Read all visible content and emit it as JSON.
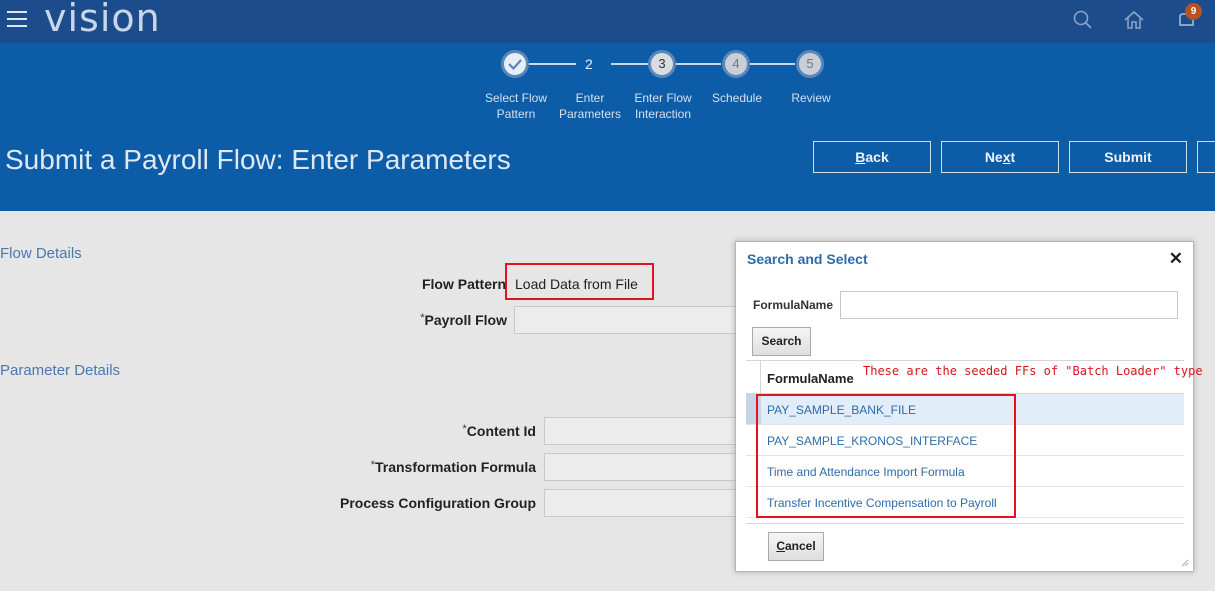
{
  "app": {
    "logo": "vision",
    "notification_count": "9",
    "icons": [
      "menu-icon",
      "search-icon",
      "home-icon",
      "notifications-icon"
    ]
  },
  "train": {
    "steps": [
      {
        "number": "",
        "label_line1": "Select Flow",
        "label_line2": "Pattern",
        "state": "done"
      },
      {
        "number": "2",
        "label_line1": "Enter",
        "label_line2": "Parameters",
        "state": "current"
      },
      {
        "number": "3",
        "label_line1": "Enter Flow",
        "label_line2": "Interaction",
        "state": "visited"
      },
      {
        "number": "4",
        "label_line1": "Schedule",
        "label_line2": "",
        "state": "unvisited"
      },
      {
        "number": "5",
        "label_line1": "Review",
        "label_line2": "",
        "state": "unvisited"
      }
    ]
  },
  "header": {
    "title": "Submit a Payroll Flow: Enter Parameters",
    "back_prefix": "",
    "back_hotkey": "B",
    "back_rest": "ack",
    "next_prefix": "Ne",
    "next_hotkey": "x",
    "next_rest": "t",
    "submit_label": "Submit"
  },
  "flow_details": {
    "section_title": "Flow Details",
    "flow_pattern_label": "Flow Pattern",
    "flow_pattern_value": "Load Data from File",
    "payroll_flow_label": "Payroll Flow",
    "required_mark": "*"
  },
  "parameter_details": {
    "section_title": "Parameter Details",
    "content_id_label": "Content Id",
    "transformation_formula_label": "Transformation Formula",
    "process_config_label": "Process Configuration Group",
    "required_mark": "*"
  },
  "dialog": {
    "title": "Search and Select",
    "close_glyph": "✕",
    "field_label": "FormulaName",
    "field_value": "",
    "search_label": "Search",
    "column_header": "FormulaName",
    "annotation": "These are the seeded FFs of \"Batch Loader\" type",
    "rows": [
      "PAY_SAMPLE_BANK_FILE",
      "PAY_SAMPLE_KRONOS_INTERFACE",
      "Time and Attendance Import Formula",
      "Transfer Incentive Compensation to Payroll"
    ],
    "cancel_hotkey": "C",
    "cancel_rest": "ancel"
  },
  "colors": {
    "topbar": "#1c4c8c",
    "trainband": "#0c5ca8",
    "annotation_red": "#e0141e",
    "link": "#2d6cab"
  }
}
